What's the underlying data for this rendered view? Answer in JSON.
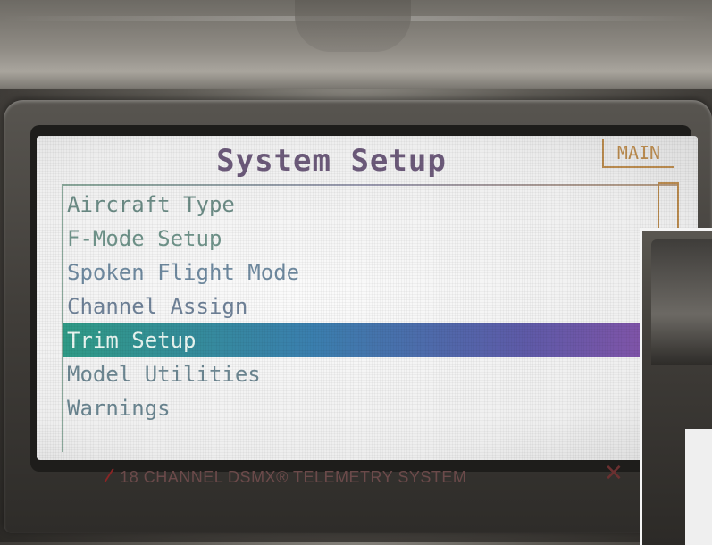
{
  "screen": {
    "title": "System Setup",
    "main_tab": "MAIN",
    "menu": [
      {
        "label": "Aircraft Type",
        "selected": false
      },
      {
        "label": "F-Mode Setup",
        "selected": false
      },
      {
        "label": "Spoken Flight Mode",
        "selected": false
      },
      {
        "label": "Channel Assign",
        "selected": false
      },
      {
        "label": "Trim Setup",
        "selected": true
      },
      {
        "label": "Model Utilities",
        "selected": false
      },
      {
        "label": "Warnings",
        "selected": false
      }
    ],
    "selected_index": 4
  },
  "device": {
    "brand_text": "18 CHANNEL DSMX® TELEMETRY SYSTEM",
    "logo_icon": "spektrum-logo-icon",
    "x_icon": "x-logo-icon"
  },
  "colors": {
    "title": "#6c5a7a",
    "main_tab": "#b98a4e",
    "selection_start": "#2f9a86",
    "selection_end": "#8a52a8",
    "menu_text": "#6c8c86"
  }
}
